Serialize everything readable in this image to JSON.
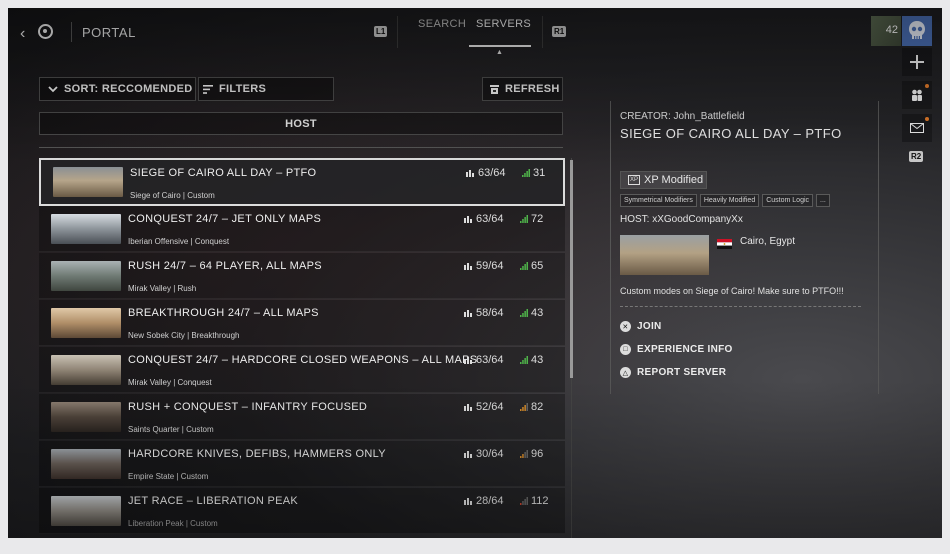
{
  "header": {
    "title": "PORTAL",
    "key_left": "L1",
    "key_right": "R1",
    "tabs": [
      {
        "label": "SEARCH",
        "active": false
      },
      {
        "label": "SERVERS",
        "active": true
      }
    ]
  },
  "rail": {
    "rank": "42",
    "key": "R2"
  },
  "controls": {
    "sort_label": "SORT: RECCOMENDED",
    "filters_label": "FILTERS",
    "refresh_label": "REFRESH",
    "host_label": "HOST"
  },
  "servers": [
    {
      "name": "SIEGE OF CAIRO ALL DAY – PTFO",
      "map": "Siege of Cairo | Custom",
      "players": "63/64",
      "ping": "31",
      "ping_color": "#4fb34a"
    },
    {
      "name": "CONQUEST 24/7 – JET ONLY MAPS",
      "map": "Iberian Offensive | Conquest",
      "players": "63/64",
      "ping": "72",
      "ping_color": "#4fb34a"
    },
    {
      "name": "RUSH 24/7 – 64  PLAYER, ALL MAPS",
      "map": "Mirak Valley | Rush",
      "players": "59/64",
      "ping": "65",
      "ping_color": "#4fb34a"
    },
    {
      "name": "BREAKTHROUGH 24/7 – ALL MAPS",
      "map": "New Sobek City | Breakthrough",
      "players": "58/64",
      "ping": "43",
      "ping_color": "#4fb34a"
    },
    {
      "name": "CONQUEST 24/7 – HARDCORE CLOSED WEAPONS – ALL MAPS",
      "map": "Mirak Valley | Conquest",
      "players": "63/64",
      "ping": "43",
      "ping_color": "#4fb34a"
    },
    {
      "name": "RUSH + CONQUEST – INFANTRY FOCUSED",
      "map": "Saints Quarter | Custom",
      "players": "52/64",
      "ping": "82",
      "ping_color": "#d38a2a"
    },
    {
      "name": "HARDCORE KNIVES, DEFIBS, HAMMERS ONLY",
      "map": "Empire State | Custom",
      "players": "30/64",
      "ping": "96",
      "ping_color": "#d38a2a"
    },
    {
      "name": "JET RACE – LIBERATION PEAK",
      "map": "Liberation Peak | Custom",
      "players": "28/64",
      "ping": "112",
      "ping_color": "#c9452f"
    }
  ],
  "details": {
    "creator": "CREATOR:  John_Battlefield",
    "title": "SIEGE OF CAIRO ALL DAY – PTFO",
    "xp_badge": "XP Modified",
    "xp_icon": "XP",
    "tags": [
      "Symmetrical Modifiers",
      "Heavily Modified",
      "Custom Logic",
      "..."
    ],
    "host": "HOST:  xXGoodCompanyXx",
    "location": "Cairo, Egypt",
    "description": "Custom modes on Siege of Cairo! Make sure to PTFO!!!",
    "actions": [
      {
        "label": "JOIN",
        "icon": "✕"
      },
      {
        "label": "EXPERIENCE INFO",
        "icon": "□"
      },
      {
        "label": "REPORT SERVER",
        "icon": "△"
      }
    ]
  }
}
